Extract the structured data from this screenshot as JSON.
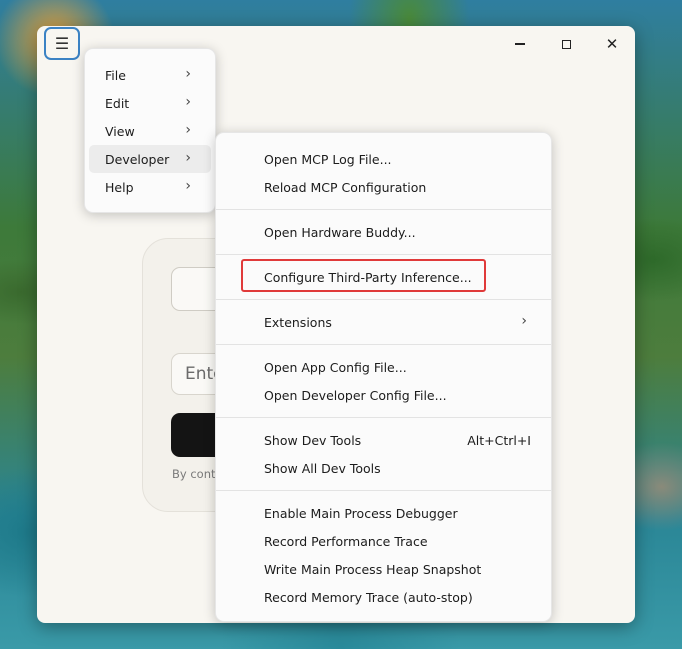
{
  "window": {
    "menu_icon": "hamburger-icon",
    "controls": {
      "minimize": "minimize-icon",
      "maximize": "maximize-icon",
      "close": "close-icon"
    }
  },
  "login_card": {
    "input_placeholder": "Ente",
    "legal_text": "By conti"
  },
  "main_menu": {
    "items": [
      {
        "label": "File"
      },
      {
        "label": "Edit"
      },
      {
        "label": "View"
      },
      {
        "label": "Developer",
        "active": true
      },
      {
        "label": "Help"
      }
    ]
  },
  "developer_menu": {
    "groups": [
      [
        "Open MCP Log File...",
        "Reload MCP Configuration"
      ],
      [
        "Open Hardware Buddy..."
      ],
      [
        "Configure Third-Party Inference..."
      ],
      [
        "Extensions"
      ],
      [
        "Open App Config File...",
        "Open Developer Config File..."
      ],
      [
        "Show Dev Tools",
        "Show All Dev Tools"
      ],
      [
        "Enable Main Process Debugger",
        "Record Performance Trace",
        "Write Main Process Heap Snapshot",
        "Record Memory Trace (auto-stop)"
      ]
    ],
    "shortcut_show_dev_tools": "Alt+Ctrl+I",
    "highlighted": "Configure Third-Party Inference...",
    "highlight_color": "#e03a3a"
  }
}
